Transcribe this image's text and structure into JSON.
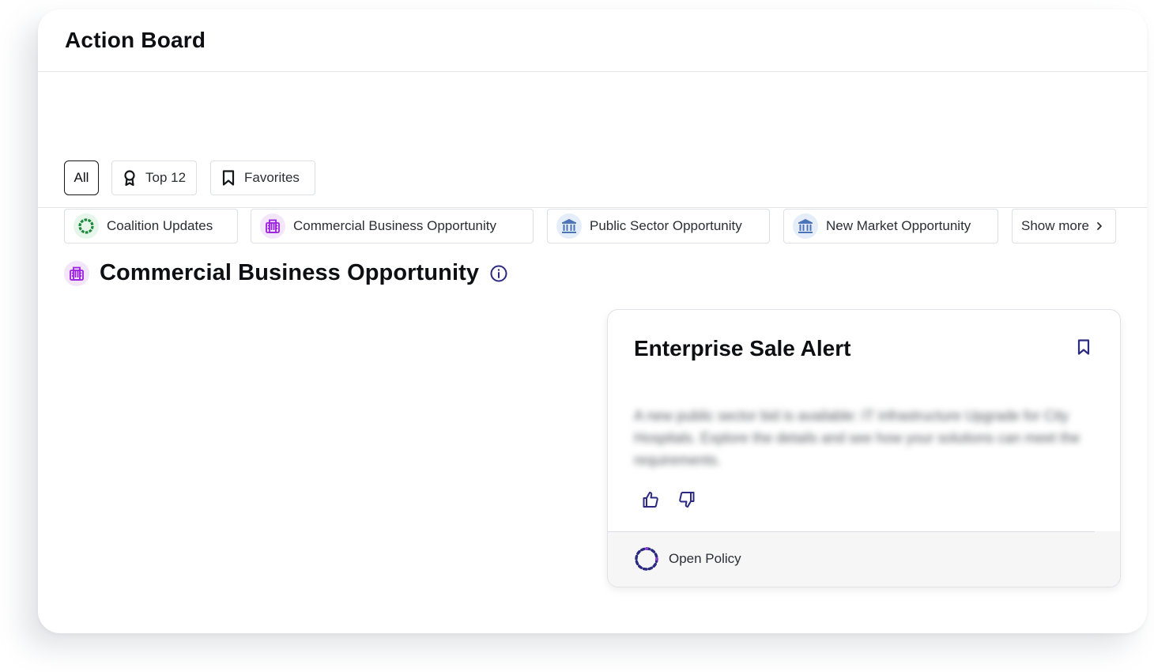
{
  "header": {
    "title": "Action Board"
  },
  "quick_filters": [
    {
      "label": "All",
      "active": true
    },
    {
      "label": "Top 12",
      "icon": "award-icon"
    },
    {
      "label": "Favorites",
      "icon": "bookmark-icon"
    }
  ],
  "categories": [
    {
      "label": "Coalition Updates",
      "icon": "coalition-ring-icon"
    },
    {
      "label": "Commercial Business Opportunity",
      "icon": "building-icon"
    },
    {
      "label": "Public Sector Opportunity",
      "icon": "bank-icon"
    },
    {
      "label": "New Market Opportunity",
      "icon": "bank-icon"
    },
    {
      "label": "Show more",
      "icon": "chevron-right-icon"
    }
  ],
  "section": {
    "title": "Commercial Business Opportunity",
    "info_icon": "info-icon"
  },
  "card": {
    "title": "Enterprise Sale Alert",
    "description": "A new public sector bid is available: IT infrastructure Upgrade for City Hospitals. Explore the details and see how your solutions can meet the requirements.",
    "footer_label": "Open Policy"
  },
  "colors": {
    "green": "#1a8a3a",
    "purple": "#9b1fe0",
    "blue": "#4a73b8",
    "navy": "#2b2a80"
  }
}
